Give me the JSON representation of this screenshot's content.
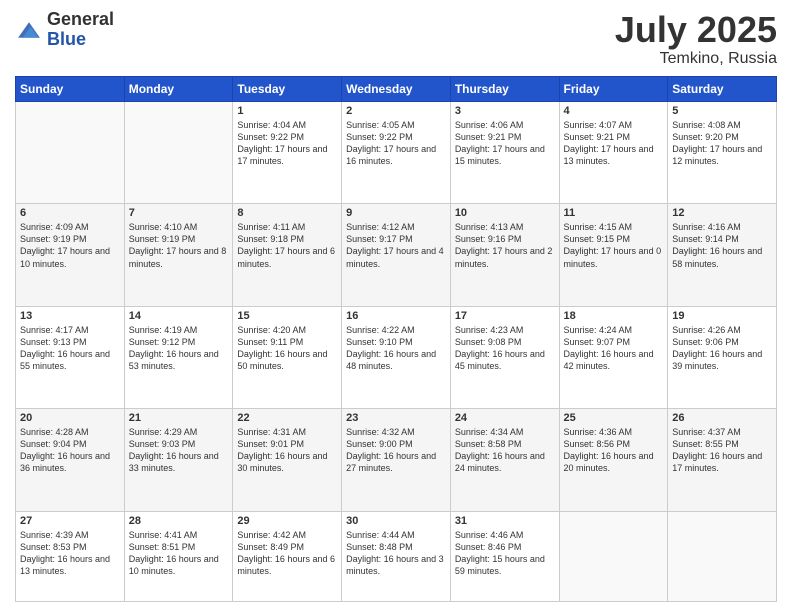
{
  "logo": {
    "general": "General",
    "blue": "Blue"
  },
  "title": {
    "month_year": "July 2025",
    "location": "Temkino, Russia"
  },
  "weekdays": [
    "Sunday",
    "Monday",
    "Tuesday",
    "Wednesday",
    "Thursday",
    "Friday",
    "Saturday"
  ],
  "weeks": [
    [
      {
        "day": "",
        "info": ""
      },
      {
        "day": "",
        "info": ""
      },
      {
        "day": "1",
        "info": "Sunrise: 4:04 AM\nSunset: 9:22 PM\nDaylight: 17 hours and 17 minutes."
      },
      {
        "day": "2",
        "info": "Sunrise: 4:05 AM\nSunset: 9:22 PM\nDaylight: 17 hours and 16 minutes."
      },
      {
        "day": "3",
        "info": "Sunrise: 4:06 AM\nSunset: 9:21 PM\nDaylight: 17 hours and 15 minutes."
      },
      {
        "day": "4",
        "info": "Sunrise: 4:07 AM\nSunset: 9:21 PM\nDaylight: 17 hours and 13 minutes."
      },
      {
        "day": "5",
        "info": "Sunrise: 4:08 AM\nSunset: 9:20 PM\nDaylight: 17 hours and 12 minutes."
      }
    ],
    [
      {
        "day": "6",
        "info": "Sunrise: 4:09 AM\nSunset: 9:19 PM\nDaylight: 17 hours and 10 minutes."
      },
      {
        "day": "7",
        "info": "Sunrise: 4:10 AM\nSunset: 9:19 PM\nDaylight: 17 hours and 8 minutes."
      },
      {
        "day": "8",
        "info": "Sunrise: 4:11 AM\nSunset: 9:18 PM\nDaylight: 17 hours and 6 minutes."
      },
      {
        "day": "9",
        "info": "Sunrise: 4:12 AM\nSunset: 9:17 PM\nDaylight: 17 hours and 4 minutes."
      },
      {
        "day": "10",
        "info": "Sunrise: 4:13 AM\nSunset: 9:16 PM\nDaylight: 17 hours and 2 minutes."
      },
      {
        "day": "11",
        "info": "Sunrise: 4:15 AM\nSunset: 9:15 PM\nDaylight: 17 hours and 0 minutes."
      },
      {
        "day": "12",
        "info": "Sunrise: 4:16 AM\nSunset: 9:14 PM\nDaylight: 16 hours and 58 minutes."
      }
    ],
    [
      {
        "day": "13",
        "info": "Sunrise: 4:17 AM\nSunset: 9:13 PM\nDaylight: 16 hours and 55 minutes."
      },
      {
        "day": "14",
        "info": "Sunrise: 4:19 AM\nSunset: 9:12 PM\nDaylight: 16 hours and 53 minutes."
      },
      {
        "day": "15",
        "info": "Sunrise: 4:20 AM\nSunset: 9:11 PM\nDaylight: 16 hours and 50 minutes."
      },
      {
        "day": "16",
        "info": "Sunrise: 4:22 AM\nSunset: 9:10 PM\nDaylight: 16 hours and 48 minutes."
      },
      {
        "day": "17",
        "info": "Sunrise: 4:23 AM\nSunset: 9:08 PM\nDaylight: 16 hours and 45 minutes."
      },
      {
        "day": "18",
        "info": "Sunrise: 4:24 AM\nSunset: 9:07 PM\nDaylight: 16 hours and 42 minutes."
      },
      {
        "day": "19",
        "info": "Sunrise: 4:26 AM\nSunset: 9:06 PM\nDaylight: 16 hours and 39 minutes."
      }
    ],
    [
      {
        "day": "20",
        "info": "Sunrise: 4:28 AM\nSunset: 9:04 PM\nDaylight: 16 hours and 36 minutes."
      },
      {
        "day": "21",
        "info": "Sunrise: 4:29 AM\nSunset: 9:03 PM\nDaylight: 16 hours and 33 minutes."
      },
      {
        "day": "22",
        "info": "Sunrise: 4:31 AM\nSunset: 9:01 PM\nDaylight: 16 hours and 30 minutes."
      },
      {
        "day": "23",
        "info": "Sunrise: 4:32 AM\nSunset: 9:00 PM\nDaylight: 16 hours and 27 minutes."
      },
      {
        "day": "24",
        "info": "Sunrise: 4:34 AM\nSunset: 8:58 PM\nDaylight: 16 hours and 24 minutes."
      },
      {
        "day": "25",
        "info": "Sunrise: 4:36 AM\nSunset: 8:56 PM\nDaylight: 16 hours and 20 minutes."
      },
      {
        "day": "26",
        "info": "Sunrise: 4:37 AM\nSunset: 8:55 PM\nDaylight: 16 hours and 17 minutes."
      }
    ],
    [
      {
        "day": "27",
        "info": "Sunrise: 4:39 AM\nSunset: 8:53 PM\nDaylight: 16 hours and 13 minutes."
      },
      {
        "day": "28",
        "info": "Sunrise: 4:41 AM\nSunset: 8:51 PM\nDaylight: 16 hours and 10 minutes."
      },
      {
        "day": "29",
        "info": "Sunrise: 4:42 AM\nSunset: 8:49 PM\nDaylight: 16 hours and 6 minutes."
      },
      {
        "day": "30",
        "info": "Sunrise: 4:44 AM\nSunset: 8:48 PM\nDaylight: 16 hours and 3 minutes."
      },
      {
        "day": "31",
        "info": "Sunrise: 4:46 AM\nSunset: 8:46 PM\nDaylight: 15 hours and 59 minutes."
      },
      {
        "day": "",
        "info": ""
      },
      {
        "day": "",
        "info": ""
      }
    ]
  ]
}
